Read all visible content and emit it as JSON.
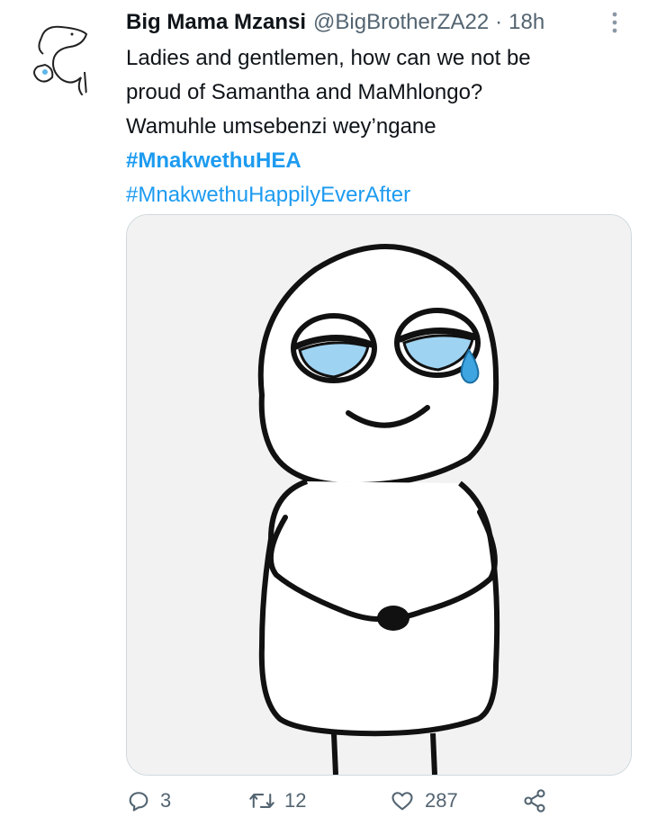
{
  "tweet": {
    "display_name": "Big Mama Mzansi",
    "handle": "@BigBrotherZA22",
    "separator": "·",
    "time": "18h",
    "text_lines": [
      "Ladies and gentlemen, how can we not be",
      "proud of Samantha and MaMhlongo?",
      "Wamuhle umsebenzi wey’ngane"
    ],
    "hashtags": [
      "#MnakwethuHEA",
      "#MnakwethuHappilyEverAfter"
    ],
    "media": {
      "description_icon": "crying-smile-meme-drawing"
    },
    "icons": {
      "more": "more-vertical-icon",
      "reply": "reply-icon",
      "retweet": "retweet-icon",
      "like": "heart-icon",
      "share": "share-icon"
    },
    "stats": {
      "replies": "3",
      "retweets": "12",
      "likes": "287"
    },
    "colors": {
      "link": "#1d9bf0",
      "muted": "#536471",
      "tear": "#5fb6e8"
    }
  }
}
